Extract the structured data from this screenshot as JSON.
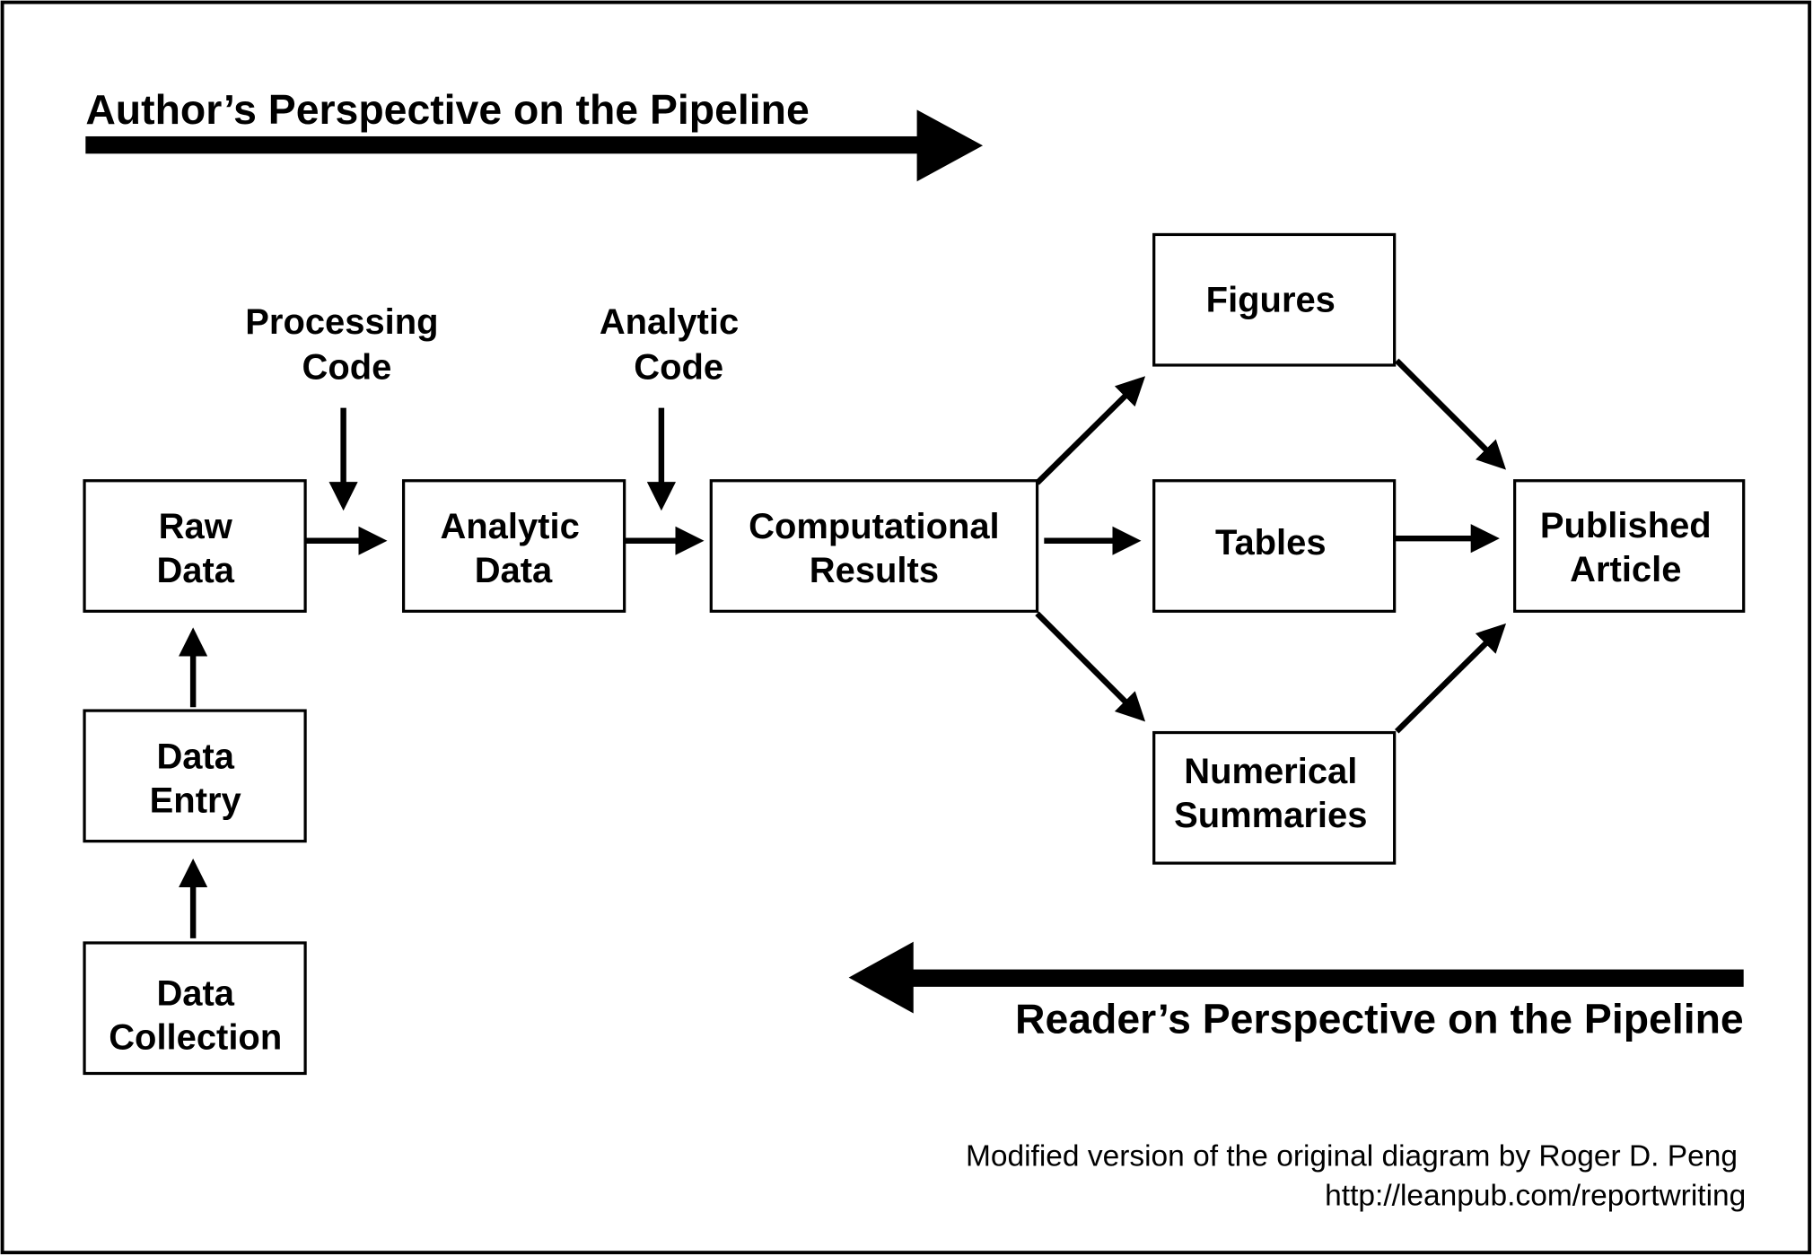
{
  "author_perspective": "Author’s Perspective on the Pipeline",
  "reader_perspective": "Reader’s Perspective on the Pipeline",
  "code_labels": {
    "processing": [
      "Processing",
      "Code"
    ],
    "analytic": [
      "Analytic",
      "Code"
    ]
  },
  "nodes": {
    "raw_data": [
      "Raw",
      "Data"
    ],
    "data_entry": [
      "Data",
      "Entry"
    ],
    "data_collection": [
      "Data",
      "Collection"
    ],
    "analytic_data": [
      "Analytic",
      "Data"
    ],
    "computational_results": [
      "Computational",
      "Results"
    ],
    "figures": [
      "Figures"
    ],
    "tables": [
      "Tables"
    ],
    "numerical_summaries": [
      "Numerical",
      "Summaries"
    ],
    "published_article": [
      "Published",
      "Article"
    ]
  },
  "credit": {
    "line1": "Modified version of the original diagram by Roger D. Peng",
    "line2": "http://leanpub.com/reportwriting"
  }
}
